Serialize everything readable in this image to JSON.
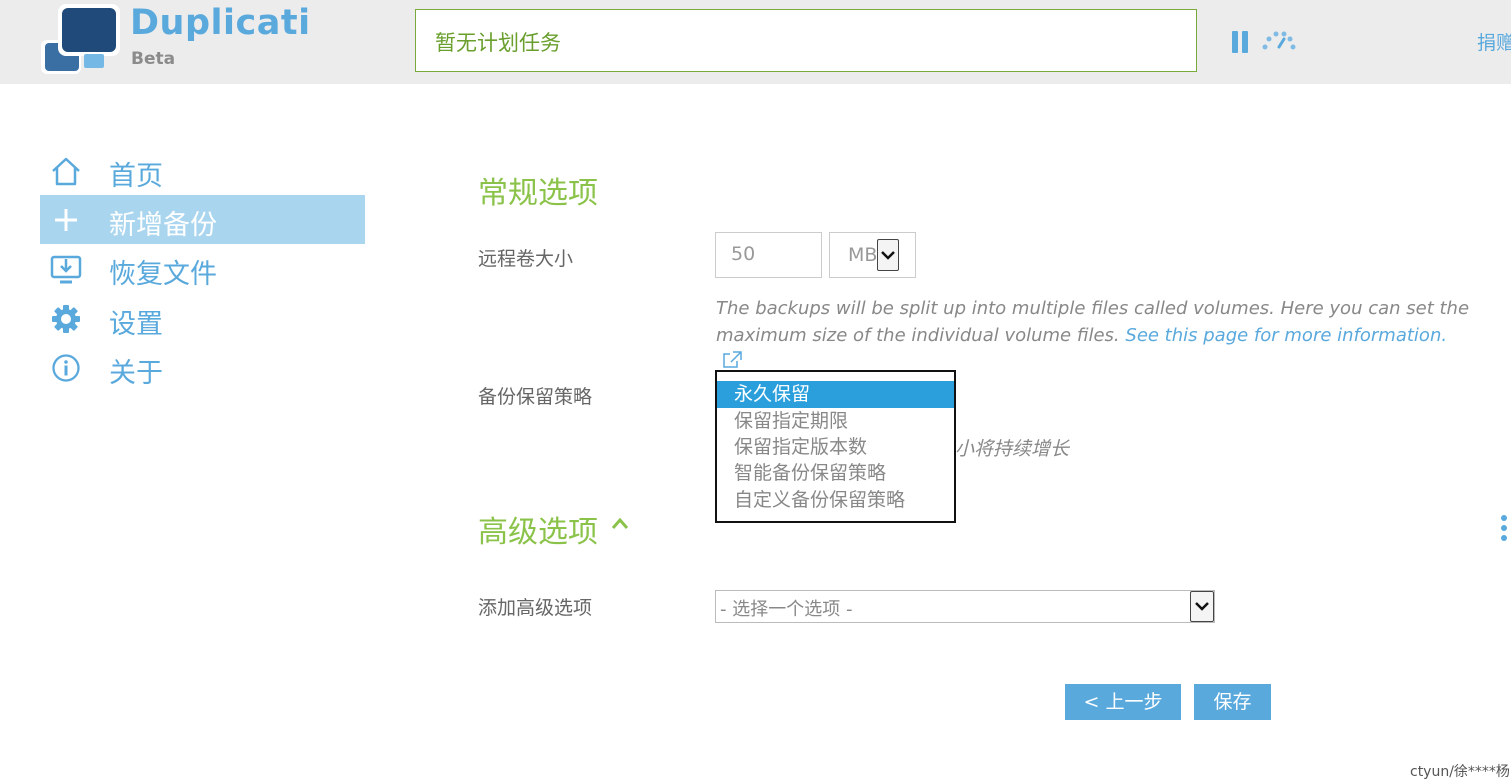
{
  "app": {
    "name": "Duplicati",
    "edition": "Beta",
    "status": "暂无计划任务",
    "donate": "捐赠"
  },
  "icons": {
    "logo": "duplicati-logo-icon",
    "pause": "pause-icon",
    "throttle": "speedometer-icon",
    "home": "home-icon",
    "add": "plus-icon",
    "restore": "download-icon",
    "settings": "gear-icon",
    "about": "info-icon"
  },
  "colors": {
    "accent": "#5aa9dd",
    "green": "#8bc34a",
    "selected": "#2a9fdc",
    "active_nav": "#a9d5ef"
  },
  "sidebar": {
    "items": [
      {
        "label": "首页",
        "active": false
      },
      {
        "label": "新增备份",
        "active": true
      },
      {
        "label": "恢复文件",
        "active": false
      },
      {
        "label": "设置",
        "active": false
      },
      {
        "label": "关于",
        "active": false
      }
    ]
  },
  "main": {
    "general_title": "常规选项",
    "volume_size_label": "远程卷大小",
    "volume_size_value": "50",
    "volume_size_unit": "MB",
    "volume_help": "The backups will be split up into multiple files called volumes. Here you can set the maximum size of the individual volume files.",
    "volume_help_link": "See this page for more information.",
    "retention_label": "备份保留策略",
    "retention_hint_visible": "小将持续增长",
    "retention_options": [
      "永久保留",
      "保留指定期限",
      "保留指定版本数",
      "智能备份保留策略",
      "自定义备份保留策略"
    ],
    "retention_selected": "永久保留",
    "advanced_title": "高级选项",
    "add_advanced_label": "添加高级选项",
    "add_advanced_placeholder": "- 选择一个选项 -",
    "prev_button": "< 上一步",
    "save_button": "保存"
  },
  "watermark": "ctyun/徐****杨"
}
